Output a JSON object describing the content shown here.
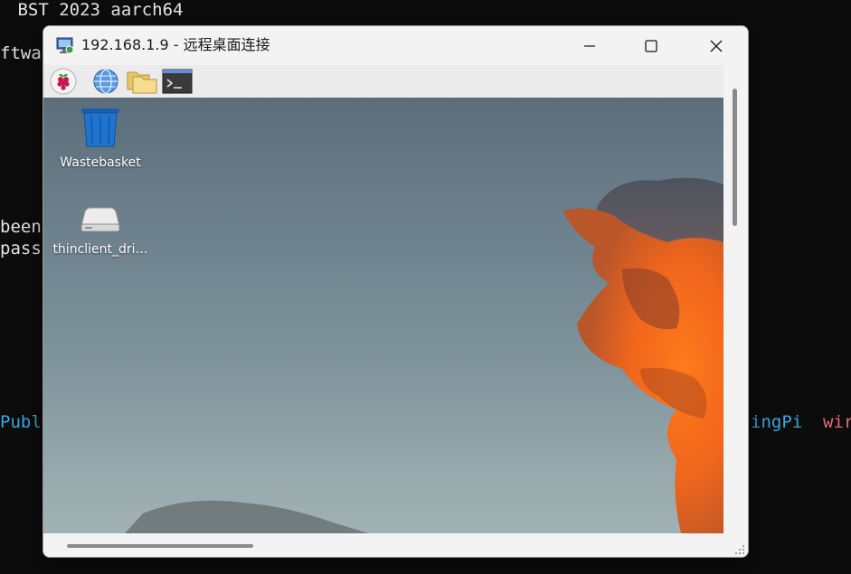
{
  "terminal": {
    "lines": [
      {
        "text": " BST 2023 aarch64",
        "color": "#e6e6e6"
      },
      {
        "text": "ftwa",
        "color": "#e6e6e6"
      },
      {
        "text": "been",
        "color": "#e6e6e6"
      },
      {
        "text": "pass",
        "color": "#e6e6e6"
      },
      {
        "text": "Publ",
        "color": "#3aa8e0"
      },
      {
        "text": "ingPi",
        "color": "#3aa8e0"
      },
      {
        "text": "wir",
        "color": "#e06c75"
      }
    ]
  },
  "window": {
    "title": "192.168.1.9 - 远程桌面连接",
    "app_icon": "remote-desktop-icon",
    "controls": {
      "minimize": "minimize-icon",
      "maximize": "maximize-icon",
      "close": "close-icon"
    }
  },
  "taskbar": {
    "icons": [
      "raspberry-pi-menu-icon",
      "web-browser-icon",
      "file-manager-icon",
      "terminal-icon"
    ]
  },
  "desktop": {
    "items": [
      {
        "label": "Wastebasket",
        "icon": "wastebasket-icon"
      },
      {
        "label": "thinclient_dri…",
        "icon": "drive-icon"
      }
    ]
  }
}
